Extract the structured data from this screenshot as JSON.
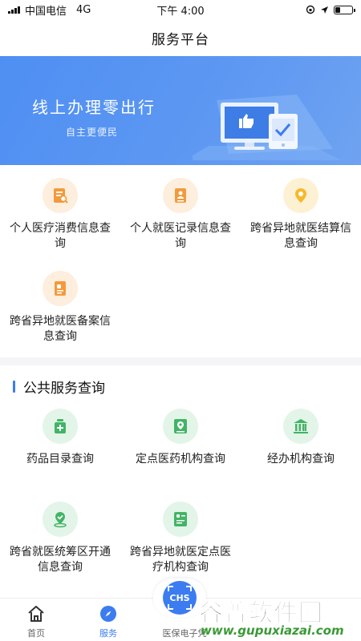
{
  "status_bar": {
    "carrier": "中国电信",
    "network": "4G",
    "time": "下午 4:00"
  },
  "nav": {
    "title": "服务平台"
  },
  "banner": {
    "title": "线上办理零出行",
    "subtitle": "自主更便民"
  },
  "services": [
    {
      "label": "个人医疗消费信息查询",
      "icon": "medical-bill-search-icon"
    },
    {
      "label": "个人就医记录信息查询",
      "icon": "medical-record-icon"
    },
    {
      "label": "跨省异地就医结算信息查询",
      "icon": "location-pin-icon"
    },
    {
      "label": "跨省异地就医备案信息查询",
      "icon": "filing-document-icon"
    }
  ],
  "public_section": {
    "title": "公共服务查询",
    "items": [
      {
        "label": "药品目录查询",
        "icon": "medicine-bottle-icon"
      },
      {
        "label": "定点医药机构查询",
        "icon": "designated-pharmacy-icon"
      },
      {
        "label": "经办机构查询",
        "icon": "institution-building-icon"
      },
      {
        "label": "跨省就医统筹区开通信息查询",
        "icon": "region-shield-icon"
      },
      {
        "label": "跨省异地就医定点医疗机构查询",
        "icon": "medical-institution-card-icon"
      }
    ]
  },
  "tabs": [
    {
      "label": "首页",
      "icon": "home-icon"
    },
    {
      "label": "服务",
      "icon": "compass-icon"
    },
    {
      "label": "医保电子凭",
      "icon": "chs-icon"
    }
  ],
  "chs_badge": "CHS",
  "watermark": {
    "text": "谷普软件园",
    "url": "www.gupuxiazai.com"
  },
  "colors": {
    "accent": "#3b7cf0",
    "orange": "#f29a3c",
    "yellow": "#f7b82b",
    "green": "#42b466",
    "banner": "#5a95f2"
  }
}
